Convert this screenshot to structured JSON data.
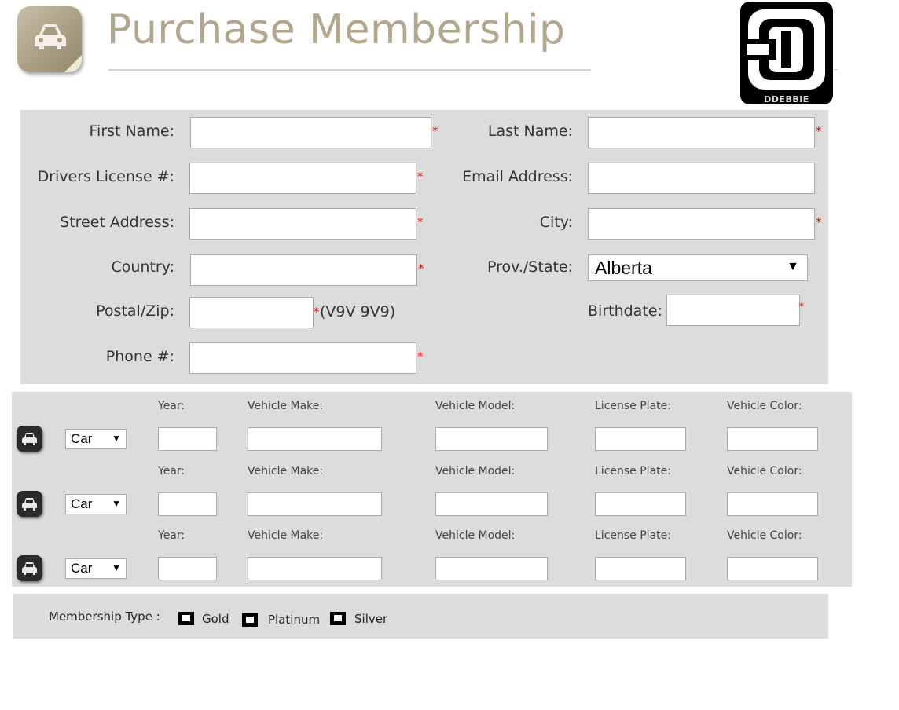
{
  "header": {
    "title": "Purchase Membership",
    "app_icon": "car-sticker-icon",
    "logo_text": "DDEBBIE"
  },
  "personal": {
    "first_name": {
      "label": "First Name:",
      "value": "",
      "required": "*"
    },
    "last_name": {
      "label": "Last Name:",
      "value": "",
      "required": "*"
    },
    "drivers_license": {
      "label": "Drivers License #:",
      "value": "",
      "required": "*"
    },
    "email": {
      "label": "Email Address:",
      "value": ""
    },
    "street": {
      "label": "Street Address:",
      "value": "",
      "required": "*"
    },
    "city": {
      "label": "City:",
      "value": "",
      "required": "*"
    },
    "country": {
      "label": "Country:",
      "value": "",
      "required": "*"
    },
    "province": {
      "label": "Prov./State:",
      "selected": "Alberta"
    },
    "postal": {
      "label": "Postal/Zip:",
      "value": "",
      "required": "*",
      "hint": "(V9V 9V9)"
    },
    "birthdate": {
      "label": "Birthdate:",
      "value": "",
      "required": "*"
    },
    "phone": {
      "label": "Phone #:",
      "value": "",
      "required": "*"
    }
  },
  "vehicles": {
    "columns": {
      "year": "Year:",
      "make": "Vehicle Make:",
      "model": "Vehicle Model:",
      "plate": "License Plate:",
      "color": "Vehicle Color:"
    },
    "rows": [
      {
        "type": "Car",
        "year": "",
        "make": "",
        "model": "",
        "plate": "",
        "color": ""
      },
      {
        "type": "Car",
        "year": "",
        "make": "",
        "model": "",
        "plate": "",
        "color": ""
      },
      {
        "type": "Car",
        "year": "",
        "make": "",
        "model": "",
        "plate": "",
        "color": ""
      }
    ],
    "icon": "car-icon"
  },
  "membership": {
    "label": "Membership Type :",
    "options": [
      {
        "label": "Gold",
        "checked": false
      },
      {
        "label": "Platinum",
        "checked": false
      },
      {
        "label": "Silver",
        "checked": false
      }
    ]
  },
  "colors": {
    "title": "#b2a68d",
    "panel": "#dcdcdc",
    "required": "#ee0000"
  }
}
